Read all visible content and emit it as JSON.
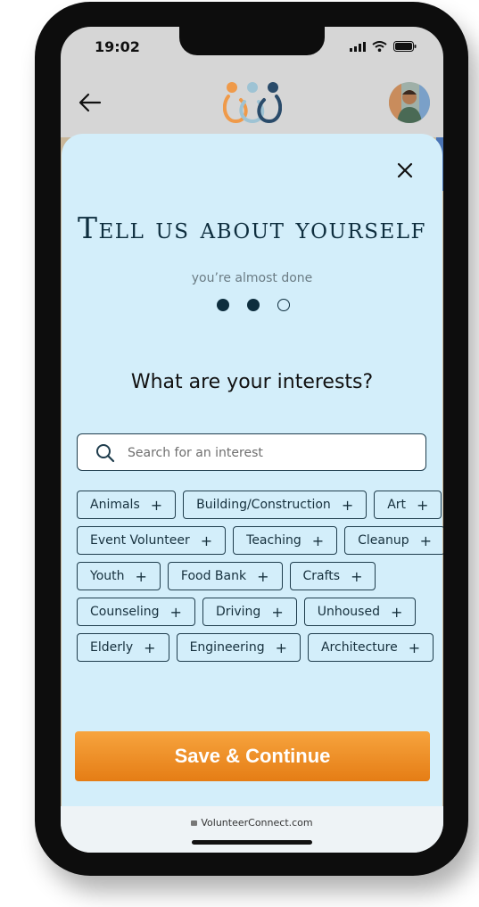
{
  "status_bar": {
    "time": "19:02"
  },
  "sheet": {
    "title": "Tell us about yourself",
    "subtitle": "you’re almost done",
    "progress": {
      "total_steps": 3,
      "completed_steps": 2
    },
    "question": "What are your interests?",
    "search": {
      "placeholder": "Search for an interest",
      "value": ""
    },
    "tag_rows": [
      [
        "Animals",
        "Building/Construction",
        "Art"
      ],
      [
        "Event Volunteer",
        "Teaching",
        "Cleanup"
      ],
      [
        "Youth",
        "Food Bank",
        "Crafts"
      ],
      [
        "Counseling",
        "Driving",
        "Unhoused"
      ],
      [
        "Elderly",
        "Engineering",
        "Architecture"
      ]
    ],
    "tag_add_symbol": "+",
    "cta_label": "Save & Continue"
  },
  "browser": {
    "url": "VolunteerConnect.com"
  },
  "colors": {
    "accent": "#f29330",
    "ink": "#0e2e3e",
    "sheet_bg": "#d3eefa"
  }
}
